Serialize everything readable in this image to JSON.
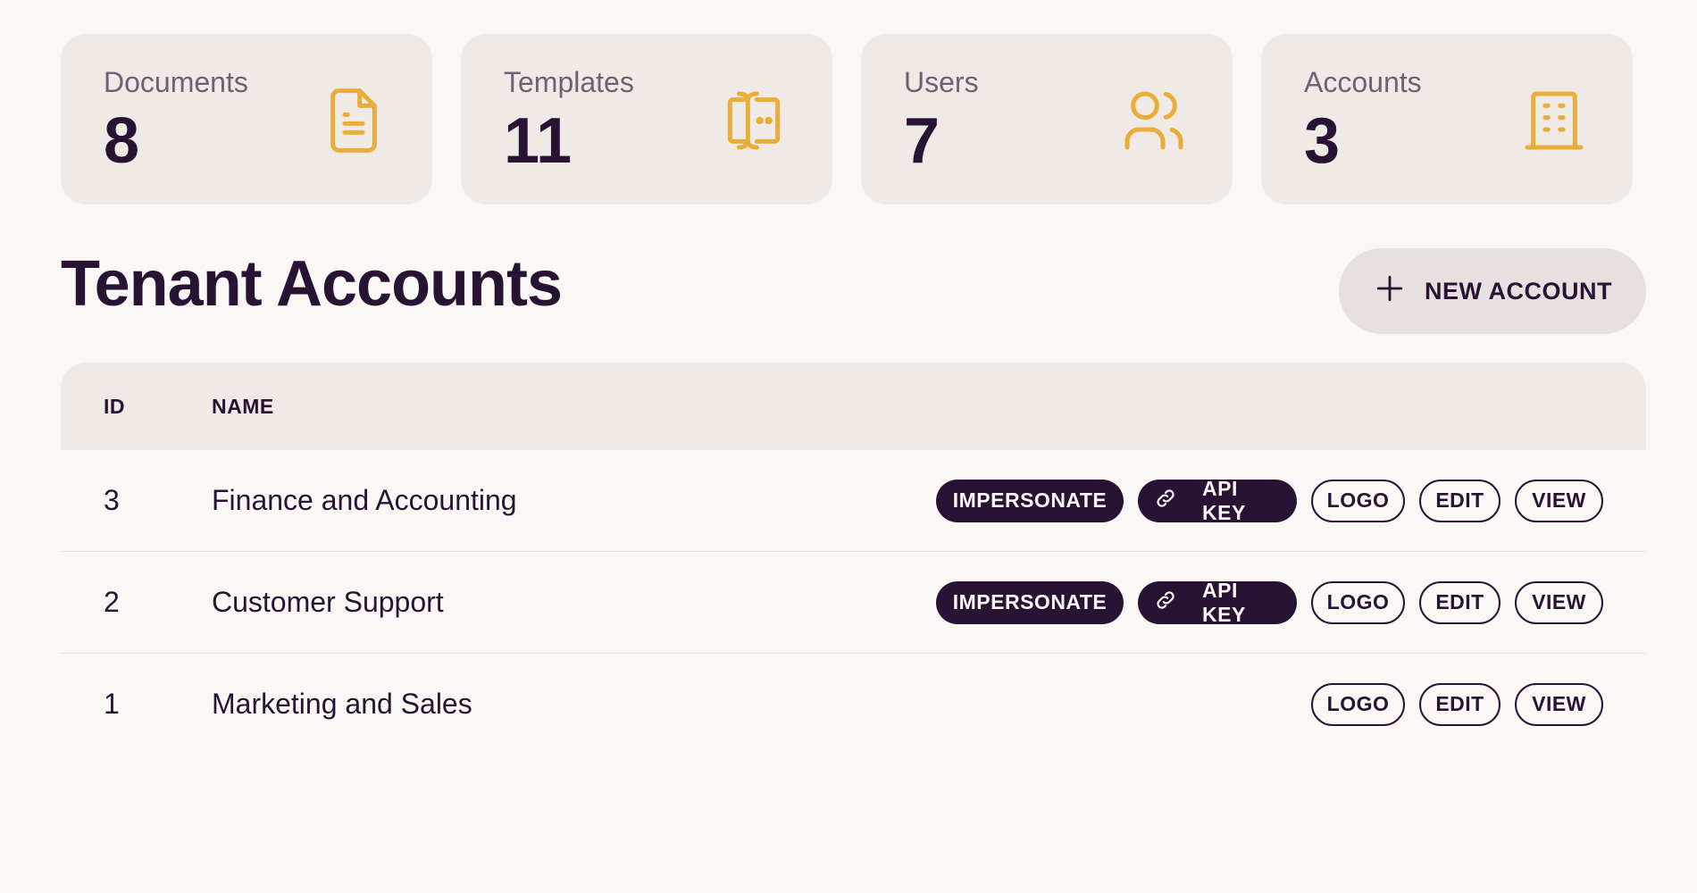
{
  "stats": [
    {
      "label": "Documents",
      "value": "8",
      "icon": "document-icon"
    },
    {
      "label": "Templates",
      "value": "11",
      "icon": "template-icon"
    },
    {
      "label": "Users",
      "value": "7",
      "icon": "users-icon"
    },
    {
      "label": "Accounts",
      "value": "3",
      "icon": "building-icon"
    }
  ],
  "header": {
    "title": "Tenant Accounts",
    "new_account_label": "NEW ACCOUNT"
  },
  "table": {
    "columns": {
      "id": "ID",
      "name": "NAME"
    },
    "rows": [
      {
        "id": "3",
        "name": "Finance and Accounting"
      },
      {
        "id": "2",
        "name": "Customer Support"
      },
      {
        "id": "1",
        "name": "Marketing and Sales"
      }
    ],
    "actions": {
      "impersonate": "IMPERSONATE",
      "api_key": "API KEY",
      "logo": "LOGO",
      "edit": "EDIT",
      "view": "VIEW"
    }
  },
  "colors": {
    "accent": "#e9ad3a",
    "primary": "#291334",
    "background": "#faf7f4",
    "card": "#efeae6"
  }
}
